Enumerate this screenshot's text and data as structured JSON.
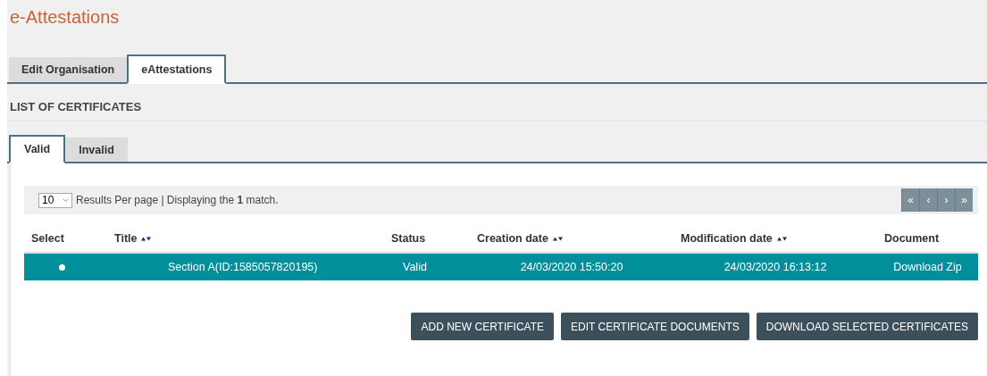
{
  "title": "e-Attestations",
  "tabs": [
    {
      "label": "Edit Organisation",
      "selected": false
    },
    {
      "label": "eAttestations",
      "selected": true
    }
  ],
  "section_title": "LIST OF CERTIFICATES",
  "subtabs": [
    {
      "label": "Valid",
      "selected": true
    },
    {
      "label": "Invalid",
      "selected": false
    }
  ],
  "pagination": {
    "per_page": "10",
    "summary": "Results Per page | Displaying the **1** match.",
    "pager": [
      "«",
      "‹",
      "›",
      "»"
    ]
  },
  "table": {
    "columns": [
      {
        "label": "Select",
        "sortable": false
      },
      {
        "label": "Title",
        "sortable": true
      },
      {
        "label": "Status",
        "sortable": false
      },
      {
        "label": "Creation date",
        "sortable": true
      },
      {
        "label": "Modification date",
        "sortable": true
      },
      {
        "label": "Document",
        "sortable": false
      }
    ],
    "rows": [
      {
        "selected": true,
        "cells": [
          "",
          "Section A(ID:1585057820195)",
          "Valid",
          "24/03/2020 15:50:20",
          "24/03/2020 16:13:12",
          "Download Zip"
        ]
      }
    ]
  },
  "buttons": [
    "ADD NEW CERTIFICATE",
    "EDIT CERTIFICATE DOCUMENTS",
    "DOWNLOAD SELECTED CERTIFICATES"
  ]
}
